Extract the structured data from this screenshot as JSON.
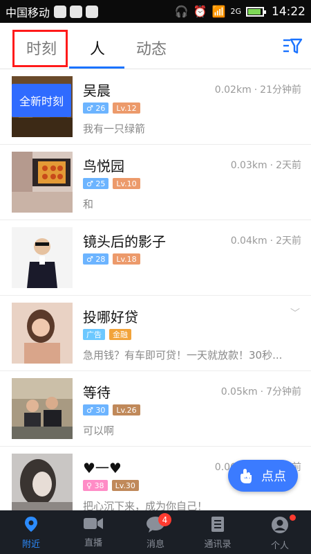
{
  "status_bar": {
    "carrier": "中国移动",
    "time": "14:22",
    "network": "2G",
    "battery_level": 0.9
  },
  "tabs": [
    {
      "label": "时刻",
      "active": false
    },
    {
      "label": "人",
      "active": true
    },
    {
      "label": "动态",
      "active": false
    }
  ],
  "feed": {
    "rows": [
      {
        "name": "吴晨",
        "distance": "0.02km",
        "time": "21分钟前",
        "gender": "♂",
        "age": "26",
        "level": "Lv.12",
        "desc": "我有一只绿箭"
      },
      {
        "name": "鸟悦园",
        "distance": "0.03km",
        "time": "2天前",
        "gender": "♂",
        "age": "25",
        "level": "Lv.10",
        "desc": "和"
      },
      {
        "name": "镜头后的影子",
        "distance": "0.04km",
        "time": "2天前",
        "gender": "♂",
        "age": "28",
        "level": "Lv.18",
        "desc": ""
      },
      {
        "name": "投哪好贷",
        "ad_label": "广告",
        "gold_label": "金融",
        "desc": "急用钱？有车即可贷！一天就放款！30秒..."
      },
      {
        "name": "等待",
        "distance": "0.05km",
        "time": "7分钟前",
        "gender": "♂",
        "age": "30",
        "level": "Lv.26",
        "desc": "可以啊"
      },
      {
        "name": "♥一♥",
        "distance": "0.06km",
        "time": "10分钟前",
        "gender": "♀",
        "age": "38",
        "level": "Lv.30",
        "desc": "把心沉下来，成为你自己！"
      }
    ],
    "new_moment_label": "全新时刻"
  },
  "fab": {
    "label": "点点"
  },
  "bottom_nav": [
    {
      "label": "附近",
      "icon": "location-pin-icon",
      "active": true
    },
    {
      "label": "直播",
      "icon": "video-camera-icon",
      "active": false
    },
    {
      "label": "消息",
      "icon": "chat-bubble-icon",
      "active": false,
      "badge": "4"
    },
    {
      "label": "通讯录",
      "icon": "contacts-book-icon",
      "active": false
    },
    {
      "label": "个人",
      "icon": "user-avatar-icon",
      "active": false,
      "dot": true
    }
  ],
  "colors": {
    "accent": "#1a73ff",
    "highlight": "#ff1a1a",
    "nav_bg": "#1b1f26"
  }
}
